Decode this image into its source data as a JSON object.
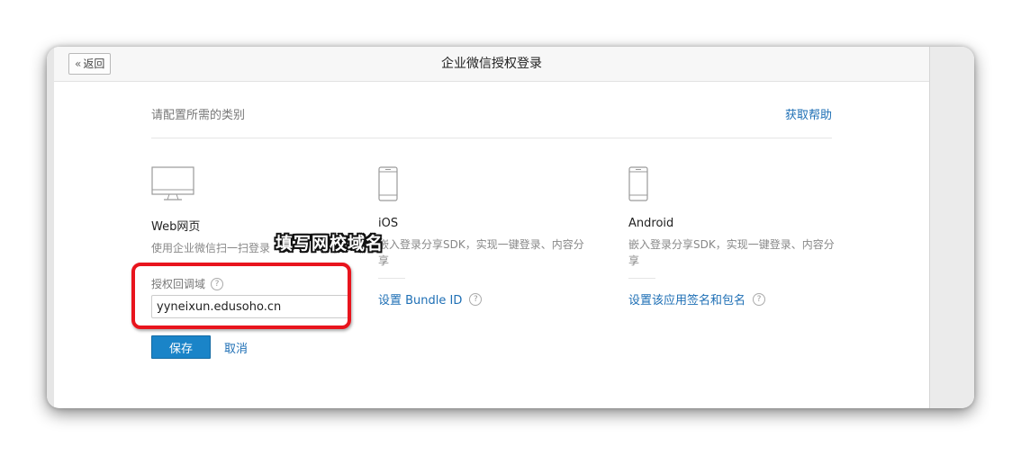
{
  "header": {
    "back_label": "返回",
    "title": "企业微信授权登录"
  },
  "section": {
    "label": "请配置所需的类别",
    "help_link": "获取帮助"
  },
  "platforms": {
    "web": {
      "title": "Web网页",
      "description": "使用企业微信扫一扫登录",
      "field_label": "授权回调域",
      "field_value": "yyneixun.edusoho.cn"
    },
    "ios": {
      "title": "iOS",
      "description": "嵌入登录分享SDK，实现一键登录、内容分享",
      "setting_link": "设置 Bundle ID"
    },
    "android": {
      "title": "Android",
      "description": "嵌入登录分享SDK，实现一键登录、内容分享",
      "setting_link": "设置该应用签名和包名"
    }
  },
  "actions": {
    "save_label": "保存",
    "cancel_label": "取消"
  },
  "annotation": {
    "text": "填写网校域名"
  },
  "colors": {
    "accent": "#1a84c8",
    "link": "#1e6fb5",
    "highlight": "#e8141d"
  }
}
